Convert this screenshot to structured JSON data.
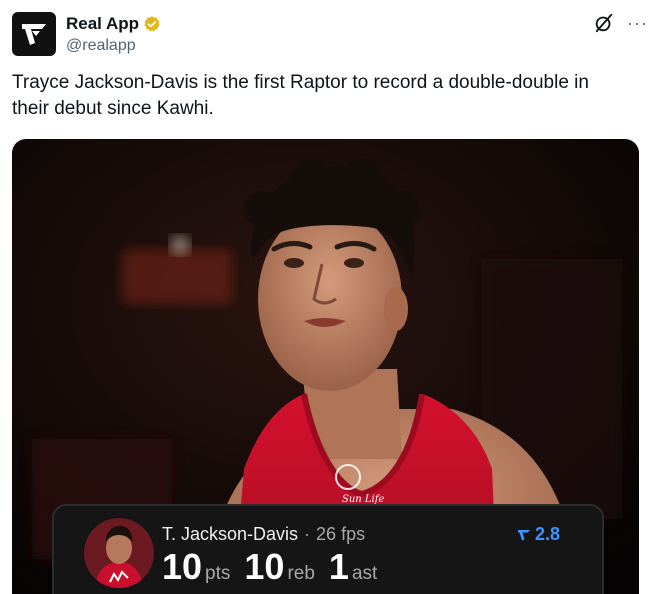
{
  "author": {
    "display_name": "Real App",
    "handle": "@realapp",
    "verified_icon": "verified-badge-icon",
    "verified_color": "#e2b719"
  },
  "header_actions": {
    "grok_icon": "grok-icon",
    "more_label": "···"
  },
  "post": {
    "text": "Trayce Jackson-Davis is the first Raptor to record a double-double in their debut since Kawhi."
  },
  "media": {
    "jersey_color": "#c8102e",
    "jersey_text": "Sun Life"
  },
  "stat_card": {
    "player_name": "T. Jackson-Davis",
    "separator": "·",
    "fps": "26 fps",
    "rating": "2.8",
    "rating_color": "#3a93ff",
    "stats": [
      {
        "value": "10",
        "unit": "pts"
      },
      {
        "value": "10",
        "unit": "reb"
      },
      {
        "value": "1",
        "unit": "ast"
      }
    ]
  }
}
